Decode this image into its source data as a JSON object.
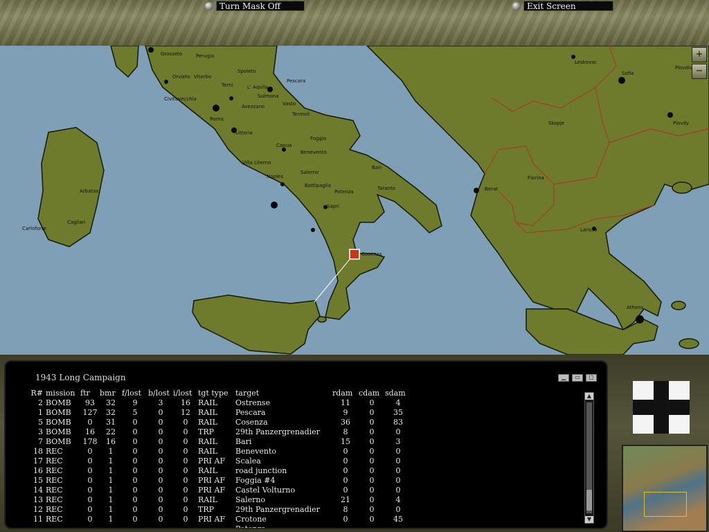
{
  "toolbar": {
    "turn_mask_label": "Turn Mask Off",
    "exit_label": "Exit Screen"
  },
  "map": {
    "zoom_in": "+",
    "zoom_out": "−",
    "cities": [
      {
        "name": "Grosseto"
      },
      {
        "name": "Perugia"
      },
      {
        "name": "Orvieto"
      },
      {
        "name": "Viterbo"
      },
      {
        "name": "Civitavecchia"
      },
      {
        "name": "Spoleto"
      },
      {
        "name": "Terni"
      },
      {
        "name": "L' Aquila"
      },
      {
        "name": "Sulmona"
      },
      {
        "name": "Avezzano"
      },
      {
        "name": "Pescara"
      },
      {
        "name": "Vasto"
      },
      {
        "name": "Termoli"
      },
      {
        "name": "Roma"
      },
      {
        "name": "Littoria"
      },
      {
        "name": "Foggia"
      },
      {
        "name": "Capua"
      },
      {
        "name": "Benevento"
      },
      {
        "name": "Villa Literno"
      },
      {
        "name": "Naples"
      },
      {
        "name": "Salerno"
      },
      {
        "name": "Battipaglia"
      },
      {
        "name": "Potenza"
      },
      {
        "name": "Bari"
      },
      {
        "name": "Taranto"
      },
      {
        "name": "Sapri"
      },
      {
        "name": "Cosenza"
      },
      {
        "name": "Arbatax"
      },
      {
        "name": "Cagliari"
      },
      {
        "name": "Carloforte"
      },
      {
        "name": "Leskovac"
      },
      {
        "name": "Sofia"
      },
      {
        "name": "Plovdiv"
      },
      {
        "name": "Skopje"
      },
      {
        "name": "Plovdy"
      },
      {
        "name": "Berat"
      },
      {
        "name": "Florina"
      },
      {
        "name": "Larissa"
      },
      {
        "name": "Athens"
      }
    ]
  },
  "report": {
    "title": "1943 Long Campaign",
    "columns": [
      "R#",
      "mission",
      "ftr",
      "bmr",
      "f/lost",
      "b/lost",
      "i/lost",
      "tgt type",
      "target",
      "rdam",
      "cdam",
      "sdam"
    ],
    "rows": [
      [
        "2",
        "BOMB",
        "93",
        "32",
        "9",
        "3",
        "16",
        "RAIL",
        "Ostrense",
        "11",
        "0",
        "4"
      ],
      [
        "1",
        "BOMB",
        "127",
        "32",
        "5",
        "0",
        "12",
        "RAIL",
        "Pescara",
        "9",
        "0",
        "35"
      ],
      [
        "5",
        "BOMB",
        "0",
        "31",
        "0",
        "0",
        "0",
        "RAIL",
        "Cosenza",
        "36",
        "0",
        "83"
      ],
      [
        "3",
        "BOMB",
        "16",
        "22",
        "0",
        "0",
        "0",
        "TRP",
        "29th Panzergrenadier",
        "8",
        "0",
        "0"
      ],
      [
        "7",
        "BOMB",
        "178",
        "16",
        "0",
        "0",
        "0",
        "RAIL",
        "Bari",
        "15",
        "0",
        "3"
      ],
      [
        "18",
        "REC",
        "0",
        "1",
        "0",
        "0",
        "0",
        "RAIL",
        "Benevento",
        "0",
        "0",
        "0"
      ],
      [
        "17",
        "REC",
        "0",
        "1",
        "0",
        "0",
        "0",
        "PRI AF",
        "Scalea",
        "0",
        "0",
        "0"
      ],
      [
        "16",
        "REC",
        "0",
        "1",
        "0",
        "0",
        "0",
        "RAIL",
        "road junction",
        "0",
        "0",
        "0"
      ],
      [
        "15",
        "REC",
        "0",
        "1",
        "0",
        "0",
        "0",
        "PRI AF",
        "Foggia #4",
        "0",
        "0",
        "0"
      ],
      [
        "14",
        "REC",
        "0",
        "1",
        "0",
        "0",
        "0",
        "PRI AF",
        "Castel Volturno",
        "0",
        "0",
        "0"
      ],
      [
        "13",
        "REC",
        "0",
        "1",
        "0",
        "0",
        "0",
        "RAIL",
        "Salerno",
        "21",
        "0",
        "4"
      ],
      [
        "12",
        "REC",
        "0",
        "1",
        "0",
        "0",
        "0",
        "TRP",
        "29th Panzergrenadier",
        "8",
        "0",
        "0"
      ],
      [
        "11",
        "REC",
        "0",
        "1",
        "0",
        "0",
        "0",
        "PRI AF",
        "Crotone",
        "0",
        "0",
        "45"
      ],
      [
        "",
        "",
        "",
        "",
        "",
        "",
        "",
        "",
        "Potenza",
        "",
        "",
        ""
      ]
    ]
  },
  "colors": {
    "sea": "#7e9fb6",
    "land": "#6e7a2c",
    "border": "#a33e2a"
  }
}
